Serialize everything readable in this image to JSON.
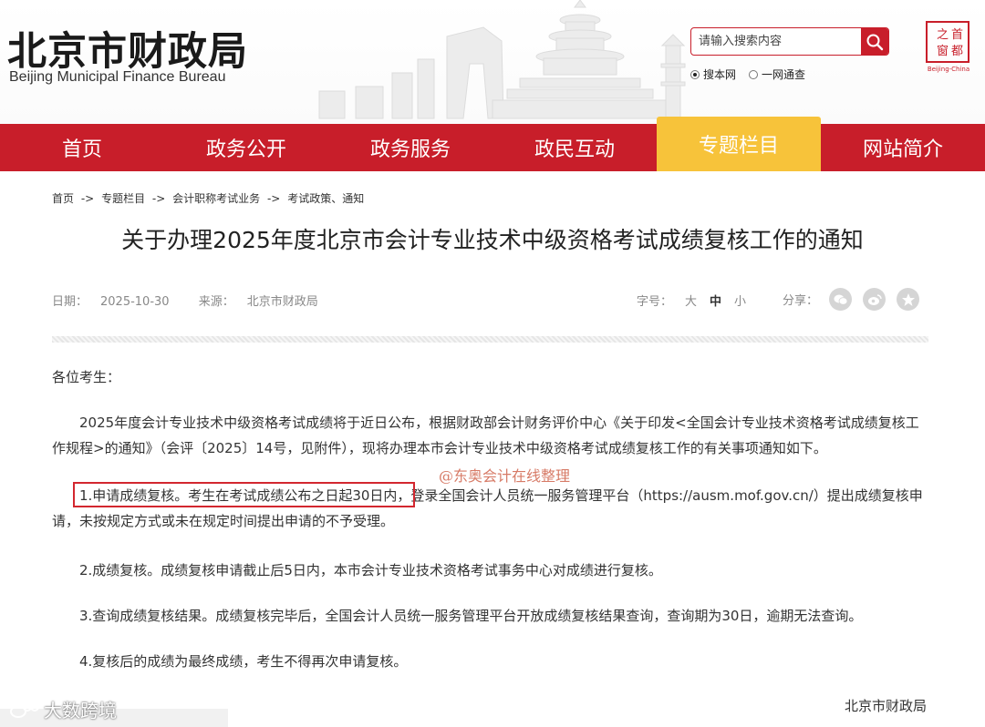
{
  "header": {
    "logo_cn": "北京市财政局",
    "logo_en": "Beijing Municipal Finance Bureau",
    "search_placeholder": "请输入搜索内容",
    "scope_options": [
      "搜本网",
      "一网通查"
    ],
    "scope_selected": "搜本网",
    "seal_text_main": "首都之窗",
    "seal_text_sub": "Beijing-China"
  },
  "nav": {
    "items": [
      "首页",
      "政务公开",
      "政务服务",
      "政民互动",
      "专题栏目",
      "网站简介"
    ],
    "active": "专题栏目"
  },
  "breadcrumb": [
    "首页",
    "->",
    "专题栏目",
    "->",
    "会计职称考试业务",
    "->",
    "考试政策、通知"
  ],
  "article": {
    "title": "关于办理2025年度北京市会计专业技术中级资格考试成绩复核工作的通知",
    "date_label": "日期：",
    "date": "2025-10-30",
    "source_label": "来源：",
    "source": "北京市财政局",
    "fontsize_label": "字号：",
    "fontsize_options": [
      "大",
      "中",
      "小"
    ],
    "fontsize_selected": "中",
    "share_label": "分享：",
    "salutation": "各位考生：",
    "paragraphs": [
      "2025年度会计专业技术中级资格考试成绩将于近日公布，根据财政部会计财务评价中心《关于印发<全国会计专业技术资格考试成绩复核工作规程>的通知》（会评〔2025〕14号，见附件），现将办理本市会计专业技术中级资格考试成绩复核工作的有关事项通知如下。",
      "1.申请成绩复核。考生在考试成绩公布之日起30日内，登录全国会计人员统一服务管理平台（https://ausm.mof.gov.cn/）提出成绩复核申请，未按规定方式或未在规定时间提出申请的不予受理。",
      "2.成绩复核。成绩复核申请截止后5日内，本市会计专业技术资格考试事务中心对成绩进行复核。",
      "3.查询成绩复核结果。成绩复核完毕后，全国会计人员统一服务管理平台开放成绩复核结果查询，查询期为30日，逾期无法查询。",
      "4.复核后的成绩为最终成绩，考生不得再次申请复核。"
    ],
    "signature": "北京市财政局"
  },
  "overlay": {
    "watermark_center": "@东奥会计在线整理",
    "watermark_corner": "大数跨境"
  }
}
